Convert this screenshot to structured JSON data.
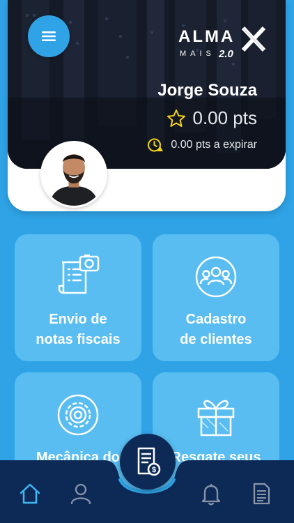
{
  "colors": {
    "primary": "#2fa3e6",
    "tile": "#59bdf1",
    "nav": "#0d2a57",
    "accent_yellow": "#f2d21b"
  },
  "header": {
    "menu_icon": "menu-icon",
    "logo": {
      "line1": "ALMAX",
      "line2": "MAIS",
      "version": "2.0"
    },
    "user_name": "Jorge Souza",
    "points": "0.00 pts",
    "expiring_points": "0.00 pts a expirar"
  },
  "tiles": [
    {
      "line1": "Envio de",
      "line2": "notas fiscais",
      "icon": "receipt-camera-icon"
    },
    {
      "line1": "Cadastro",
      "line2": "de clientes",
      "icon": "users-group-icon"
    },
    {
      "line1": "Mecânica do",
      "line2": "",
      "icon": "gear-icon"
    },
    {
      "line1": "Resgate seus",
      "line2": "",
      "icon": "gift-icon"
    }
  ],
  "bottom_nav": {
    "items": [
      {
        "icon": "home-icon",
        "active": true
      },
      {
        "icon": "user-icon",
        "active": false
      },
      {
        "icon": "invoice-money-icon",
        "active": false
      },
      {
        "icon": "bell-icon",
        "active": false
      },
      {
        "icon": "document-icon",
        "active": false
      }
    ]
  }
}
